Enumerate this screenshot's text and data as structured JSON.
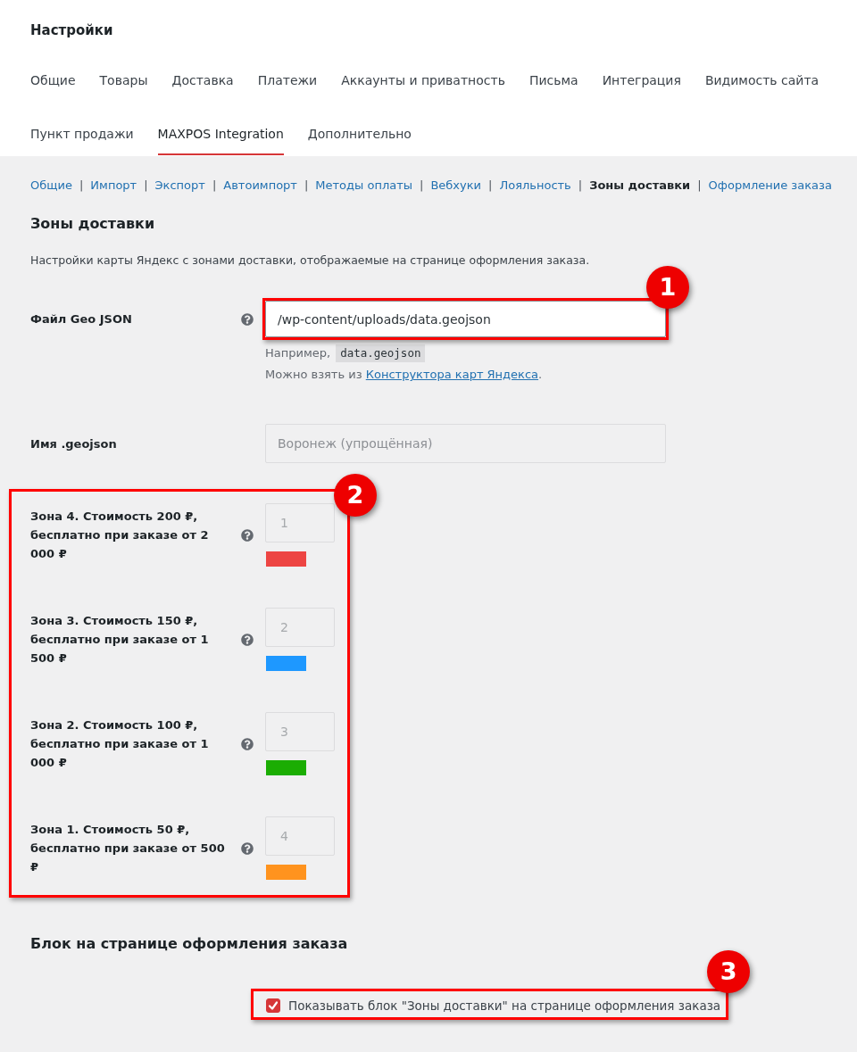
{
  "title": "Настройки",
  "tab_rows": [
    [
      {
        "label": "Общие",
        "selected": false
      },
      {
        "label": "Товары",
        "selected": false
      },
      {
        "label": "Доставка",
        "selected": false
      },
      {
        "label": "Платежи",
        "selected": false
      },
      {
        "label": "Аккаунты и приватность",
        "selected": false
      },
      {
        "label": "Письма",
        "selected": false
      },
      {
        "label": "Интеграция",
        "selected": false
      },
      {
        "label": "Видимость сайта",
        "selected": false
      }
    ],
    [
      {
        "label": "Пункт продажи",
        "selected": false
      },
      {
        "label": "MAXPOS Integration",
        "selected": true
      },
      {
        "label": "Дополнительно",
        "selected": false
      }
    ]
  ],
  "subnav": {
    "separator": "|",
    "items": [
      {
        "label": "Общие",
        "selected": false
      },
      {
        "label": "Импорт",
        "selected": false
      },
      {
        "label": "Экспорт",
        "selected": false
      },
      {
        "label": "Автоимпорт",
        "selected": false
      },
      {
        "label": "Методы оплаты",
        "selected": false
      },
      {
        "label": "Вебхуки",
        "selected": false
      },
      {
        "label": "Лояльность",
        "selected": false
      },
      {
        "label": "Зоны доставки",
        "selected": true
      },
      {
        "label": "Оформление заказа",
        "selected": false
      }
    ]
  },
  "sections": [
    {
      "heading": "Зоны доставки",
      "description": "Настройки карты Яндекс с зонами доставки, отображаемые на странице оформления заказа.",
      "fields": [
        {
          "kind": "text",
          "label": "Файл Geo JSON",
          "help": true,
          "value": "/wp-content/uploads/data.geojson",
          "callout": "1",
          "hints": [
            {
              "text": "Например,",
              "code": "data.geojson"
            },
            {
              "text": "Можно взять из",
              "link": "Конструктора карт Яндекса",
              "after": "."
            }
          ]
        },
        {
          "kind": "text",
          "label": "Имя .geojson",
          "help": false,
          "placeholder": "Воронеж (упрощённая)"
        },
        {
          "kind": "zones",
          "callout": "2",
          "zones": [
            {
              "label": "Зона 4. Стоимость 200 ₽, бесплатно при заказе от 2 000 ₽",
              "help": true,
              "placeholder": "1",
              "color": "#ed4543"
            },
            {
              "label": "Зона 3. Стоимость 150 ₽, бесплатно при заказе от 1 500 ₽",
              "help": true,
              "placeholder": "2",
              "color": "#1e98ff"
            },
            {
              "label": "Зона 2. Стоимость 100 ₽, бесплатно при заказе от 1 000 ₽",
              "help": true,
              "placeholder": "3",
              "color": "#1bad03"
            },
            {
              "label": "Зона 1. Стоимость 50 ₽, бесплатно при заказе от 500 ₽",
              "help": true,
              "placeholder": "4",
              "color": "#ff931e"
            }
          ]
        }
      ]
    },
    {
      "heading": "Блок на странице оформления заказа",
      "fields": [
        {
          "kind": "checkbox",
          "label": "Показывать блок \"Зоны доставки\" на странице оформления заказа",
          "checked": true,
          "callout": "3"
        }
      ]
    }
  ]
}
